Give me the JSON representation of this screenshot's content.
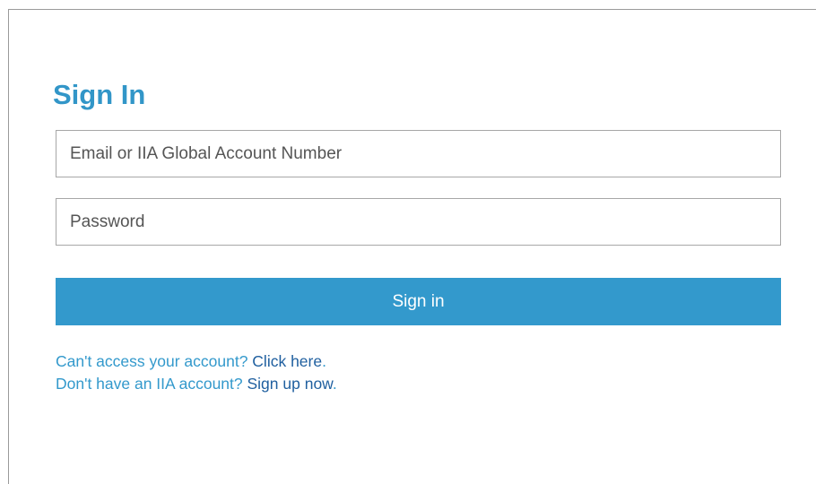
{
  "signin": {
    "title": "Sign In",
    "email_placeholder": "Email or IIA Global Account Number",
    "email_value": "",
    "password_placeholder": "Password",
    "password_value": "",
    "submit_label": "Sign in"
  },
  "help_links": {
    "access_prefix": "Can't access your account? ",
    "access_link": "Click here",
    "access_suffix": ".",
    "signup_prefix": "Don't have an IIA account? ",
    "signup_link": "Sign up now",
    "signup_suffix": "."
  },
  "colors": {
    "accent": "#3399cc",
    "title": "#3296c8",
    "link": "#1f5f9f",
    "border": "#a7a7a7"
  }
}
